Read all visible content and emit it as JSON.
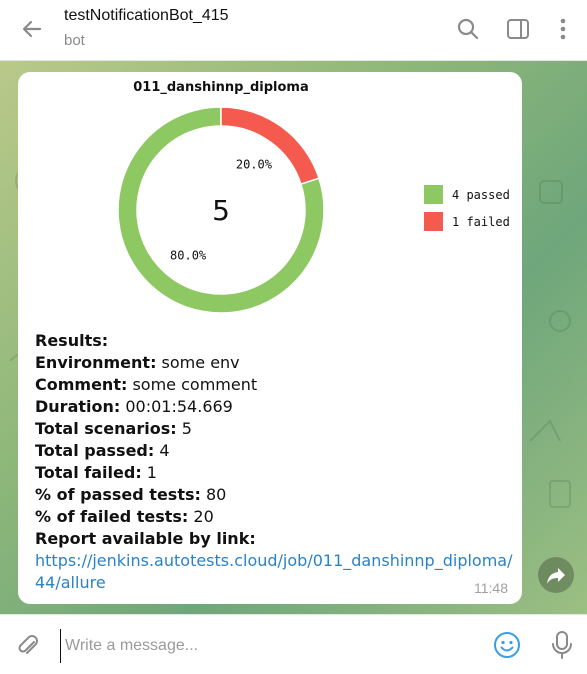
{
  "header": {
    "title": "testNotificationBot_415",
    "subtitle": "bot"
  },
  "message": {
    "time": "11:48",
    "results_heading": "Results:",
    "fields": [
      {
        "label": "Environment:",
        "value": " some env"
      },
      {
        "label": "Comment:",
        "value": " some comment"
      },
      {
        "label": "Duration:",
        "value": " 00:01:54.669"
      },
      {
        "label": "Total scenarios:",
        "value": " 5"
      },
      {
        "label": "Total passed:",
        "value": " 4"
      },
      {
        "label": "Total failed:",
        "value": " 1"
      },
      {
        "label": "% of passed tests:",
        "value": " 80"
      },
      {
        "label": "% of failed tests:",
        "value": " 20"
      }
    ],
    "report_label": "Report available by link:",
    "report_link": "https://jenkins.autotests.cloud/job/011_danshinnp_diploma/44/allure"
  },
  "chart_data": {
    "type": "pie",
    "title": "011_danshinnp_diploma",
    "center_label": "5",
    "slices": [
      {
        "label": "4 passed",
        "value": 4,
        "percent_label": "80.0%",
        "color": "#8dc862"
      },
      {
        "label": "1 failed",
        "value": 1,
        "percent_label": "20.0%",
        "color": "#f55a4e"
      }
    ]
  },
  "composer": {
    "placeholder": "Write a message..."
  },
  "colors": {
    "link": "#2a83c7",
    "emoji_accent": "#3a9fe0"
  }
}
